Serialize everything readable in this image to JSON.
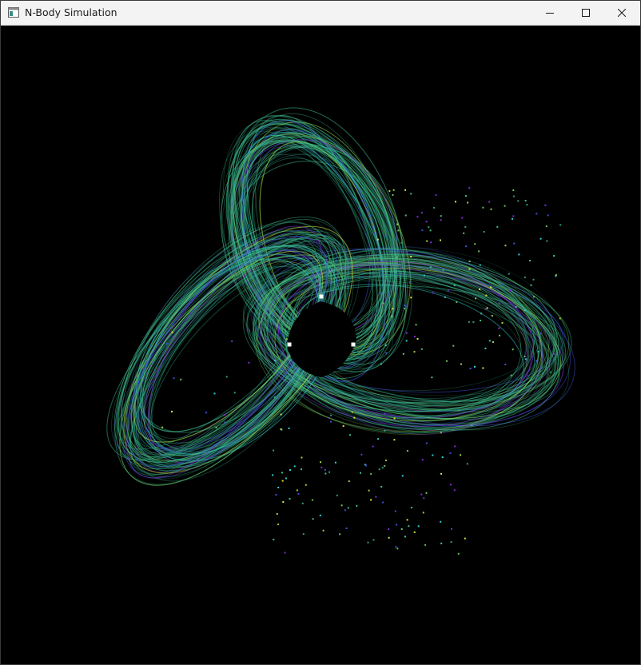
{
  "window": {
    "title": "N-Body Simulation",
    "icon": "app-window-icon",
    "controls": {
      "minimize_icon": "minimize-icon",
      "maximize_icon": "maximize-icon",
      "close_icon": "close-icon"
    }
  },
  "simulation": {
    "background_color": "#000000",
    "trail_colors": [
      "#2f9e7a",
      "#3fbf8f",
      "#6bc45a",
      "#9fd23c",
      "#d8e63a",
      "#3f4fd8",
      "#7a2fd8",
      "#2fd0d0"
    ],
    "massive_body_color": "#ffffff",
    "massive_bodies_count": 3
  }
}
